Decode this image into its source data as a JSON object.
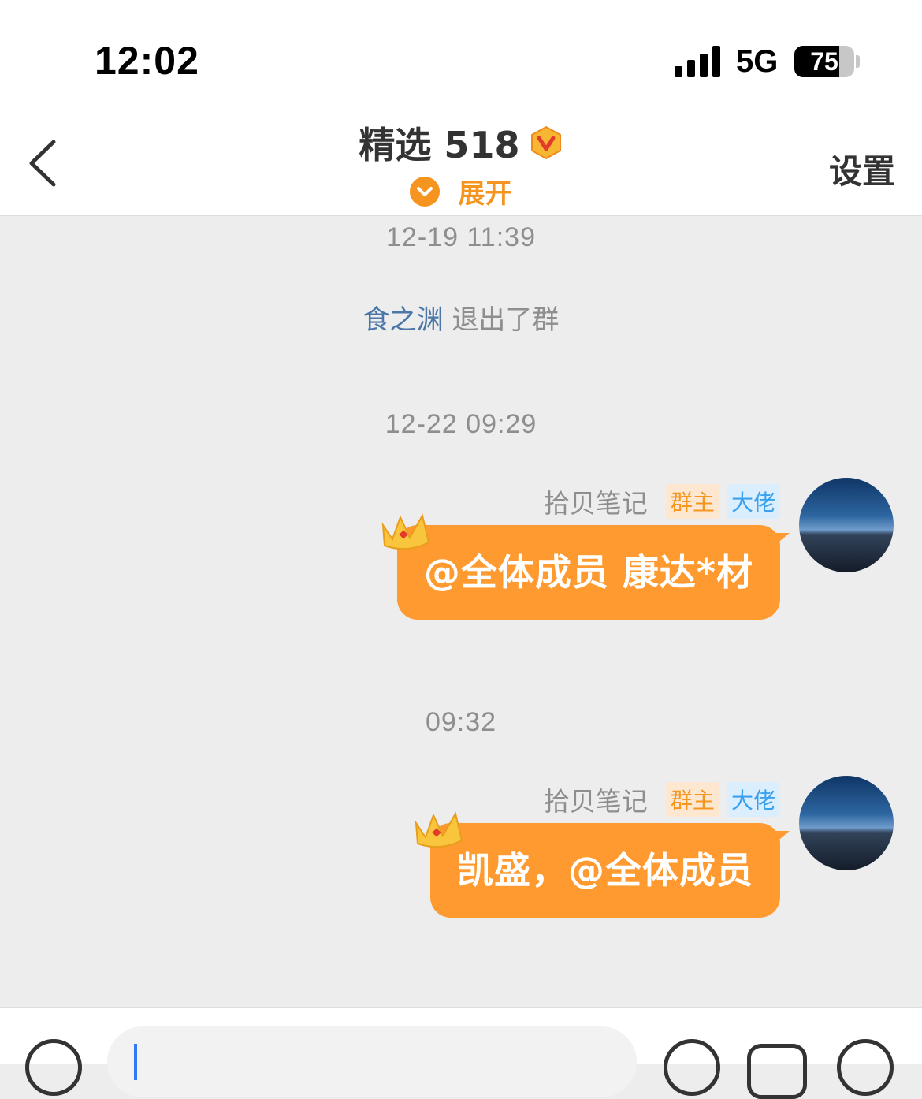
{
  "status_bar": {
    "time": "12:02",
    "network": "5G",
    "battery_level": "75",
    "battery_fraction": 0.75
  },
  "header": {
    "title": "精选 518",
    "expand_label": "展开",
    "settings_label": "设置",
    "verified_icon": "v-badge-icon"
  },
  "timeline": [
    {
      "type": "timestamp",
      "text": "12-19 11:39"
    },
    {
      "type": "system",
      "user": "食之渊",
      "text": "退出了群"
    },
    {
      "type": "timestamp",
      "text": "12-22 09:29"
    },
    {
      "type": "message",
      "sender": "拾贝笔记",
      "badges": [
        "群主",
        "大佬"
      ],
      "text": "@全体成员 康达*材"
    },
    {
      "type": "timestamp",
      "text": "09:32"
    },
    {
      "type": "message",
      "sender": "拾贝笔记",
      "badges": [
        "群主",
        "大佬"
      ],
      "text": "凯盛，@全体成员"
    }
  ],
  "colors": {
    "accent": "#f5951f",
    "bubble": "#fe9a2f",
    "background": "#ededed",
    "link": "#4a76a8"
  }
}
